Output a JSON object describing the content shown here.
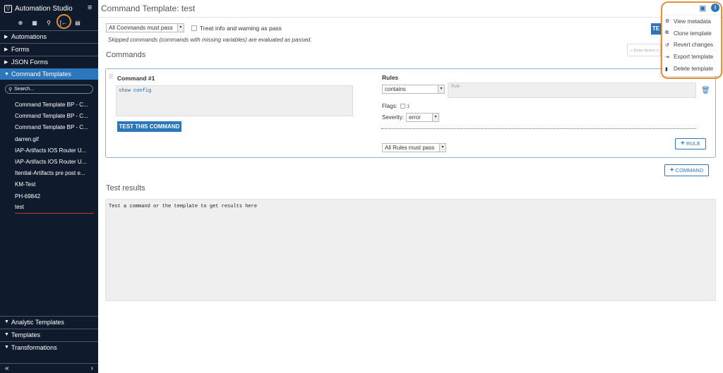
{
  "sidebar": {
    "brand": "Automation Studio",
    "sections_top": [
      {
        "label": "Automations"
      },
      {
        "label": "Forms"
      },
      {
        "label": "JSON Forms"
      }
    ],
    "active_section": "Command Templates",
    "search_placeholder": "Search...",
    "items": [
      {
        "label": "Command Template BP - C..."
      },
      {
        "label": "Command Template BP - C..."
      },
      {
        "label": "Command Template BP - C..."
      },
      {
        "label": "darren.gif"
      },
      {
        "label": "IAP-Artifacts IOS Router U..."
      },
      {
        "label": "IAP-Artifacts IOS Router U..."
      },
      {
        "label": "Itential-Artifacts pre post e..."
      },
      {
        "label": "KM-Test"
      },
      {
        "label": "PH-69842"
      },
      {
        "label": "test"
      }
    ],
    "sections_bottom": [
      {
        "label": "Analytic Templates"
      },
      {
        "label": "Templates"
      },
      {
        "label": "Transformations"
      }
    ]
  },
  "header": {
    "title": "Command Template: test"
  },
  "options": {
    "pass_mode": "All Commands must pass",
    "treat_label": "Treat info and warning as pass",
    "skipped_note": "Skipped commands (commands with missing variables) are evaluated as passed.",
    "test_button": "TE",
    "device_placeholder": "« Enter device n"
  },
  "commands": {
    "heading": "Commands",
    "title": "Command #1",
    "text": "show config",
    "test_button": "TEST THIS COMMAND",
    "rules_label": "Rules",
    "rule_type": "contains",
    "rule_placeholder": "Rule",
    "flags_label": "Flags:",
    "flags_i": ":i",
    "severity_label": "Severity:",
    "severity_value": "error",
    "rules_mode": "All Rules must pass",
    "rule_button": "RULE",
    "command_button": "COMMAND"
  },
  "results": {
    "heading": "Test results",
    "text": "Test a command or the template to get results here"
  },
  "menu": {
    "items": [
      {
        "label": "View metadata",
        "icon": "gear-icon"
      },
      {
        "label": "Clone template",
        "icon": "copy-icon"
      },
      {
        "label": "Revert changes",
        "icon": "undo-icon"
      },
      {
        "label": "Export template",
        "icon": "export-icon"
      },
      {
        "label": "Delete template",
        "icon": "trash-icon"
      }
    ]
  },
  "colors": {
    "sidebar_bg": "#0f1b2c",
    "accent": "#2c77bc",
    "highlight_ring": "#e69138"
  }
}
